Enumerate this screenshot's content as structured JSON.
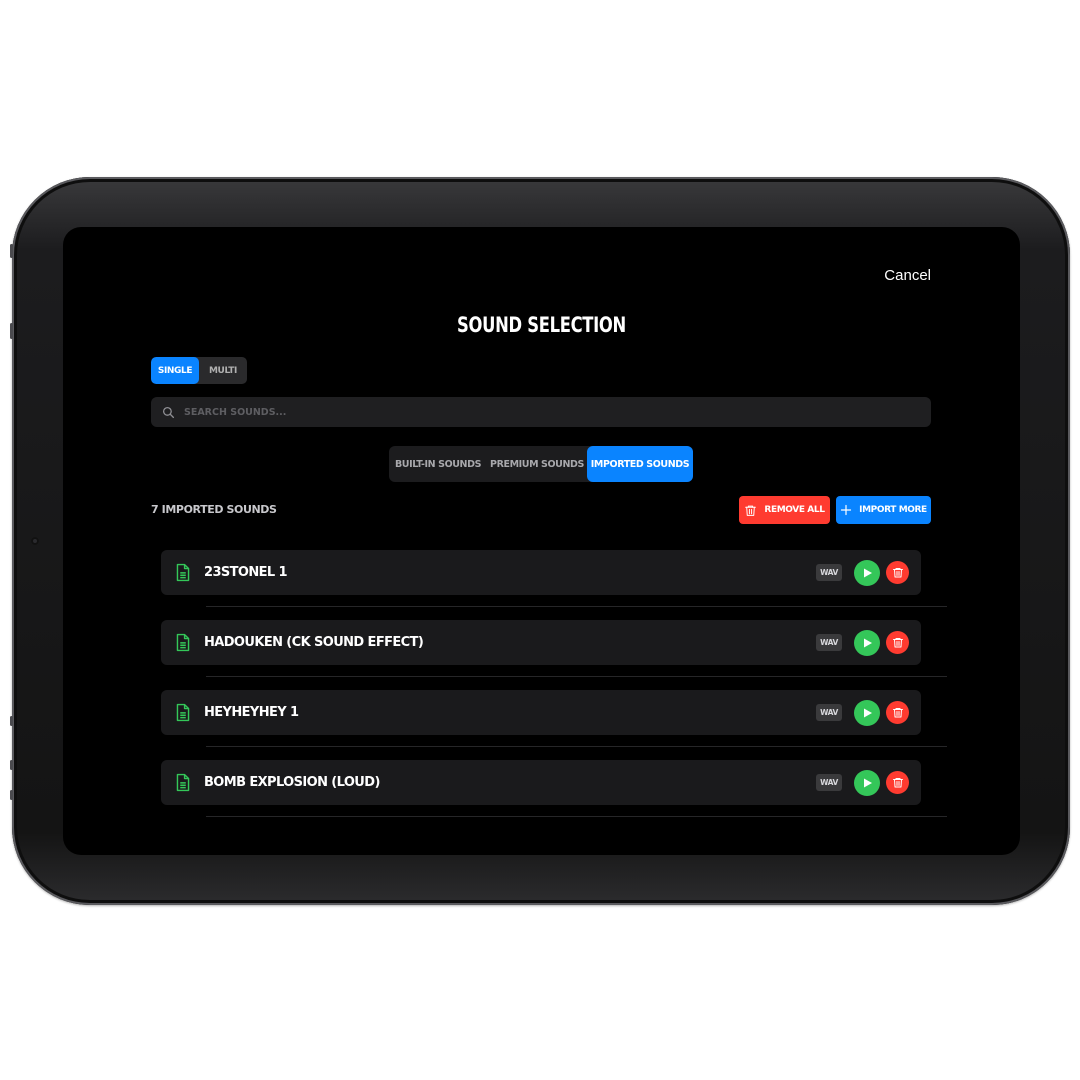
{
  "header": {
    "cancel_label": "Cancel",
    "title": "Sound Selection"
  },
  "mode_toggle": {
    "options": [
      "Single",
      "Multi"
    ],
    "selected": "Single"
  },
  "search": {
    "placeholder": "Search sounds...",
    "value": ""
  },
  "tabs": [
    {
      "label": "Built-in Sounds",
      "active": false
    },
    {
      "label": "Premium Sounds",
      "active": false
    },
    {
      "label": "Imported Sounds",
      "active": true
    }
  ],
  "toolbar": {
    "count_label": "7 Imported Sounds",
    "remove_all_label": "Remove All",
    "import_more_label": "Import More"
  },
  "sounds": [
    {
      "name": "23stonel 1",
      "format": "WAV"
    },
    {
      "name": "Hadouken (CK Sound Effect)",
      "format": "WAV"
    },
    {
      "name": "HeyHeyHey 1",
      "format": "WAV"
    },
    {
      "name": "Bomb Explosion (Loud)",
      "format": "WAV"
    }
  ],
  "colors": {
    "accent": "#0a84ff",
    "danger": "#ff3b30",
    "success": "#34c759",
    "background": "#000000"
  },
  "icons": {
    "search": "magnifier-icon",
    "file": "document-icon",
    "play": "play-icon",
    "trash": "trash-icon",
    "plus": "plus-icon"
  }
}
